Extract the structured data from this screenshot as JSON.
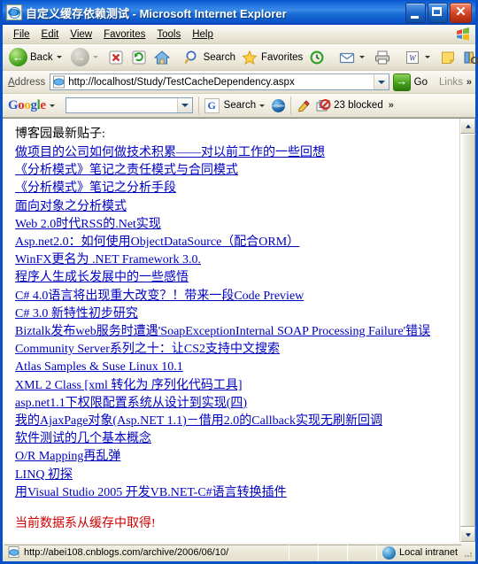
{
  "window": {
    "title_zh": "自定义缓存依赖测试",
    "title_suffix": " - Microsoft Internet Explorer",
    "icon": "ie-page-icon",
    "minimize_label": "_",
    "maximize_label": "□",
    "close_label": "✕"
  },
  "menu": {
    "items": [
      {
        "label": "File",
        "accel": "F"
      },
      {
        "label": "Edit",
        "accel": "E"
      },
      {
        "label": "View",
        "accel": "V"
      },
      {
        "label": "Favorites",
        "accel": "a"
      },
      {
        "label": "Tools",
        "accel": "T"
      },
      {
        "label": "Help",
        "accel": "H"
      }
    ],
    "brand_icon": "windows-flag-icon"
  },
  "toolbar": {
    "back_label": "Back",
    "back_icon": "back-arrow-icon",
    "forward_icon": "forward-arrow-icon",
    "stop_icon": "stop-icon",
    "refresh_icon": "refresh-icon",
    "home_icon": "home-icon",
    "search_label": "Search",
    "search_icon": "magnifier-icon",
    "favorites_label": "Favorites",
    "favorites_icon": "star-icon",
    "history_icon": "history-clock-icon",
    "mail_icon": "mail-icon",
    "print_icon": "printer-icon",
    "word_icon": "word-edit-icon",
    "notes_icon": "notes-icon",
    "research_icon": "research-icon",
    "overflow_label": "»"
  },
  "address": {
    "label": "Address",
    "icon": "ie-page-icon",
    "value": "http://localhost/Study/TestCacheDependency.aspx",
    "placeholder": "",
    "dropdown_icon": "chevron-down-icon",
    "go_label": "Go",
    "go_icon": "go-arrow-icon",
    "links_label": "Links",
    "overflow_label": "»"
  },
  "google_toolbar": {
    "logo_letters": [
      "G",
      "o",
      "o",
      "g",
      "l",
      "e"
    ],
    "dropdown_icon": "chevron-down-icon",
    "search_value": "",
    "search_placeholder": "",
    "g_icon": "google-g-icon",
    "search_label": "Search",
    "globe_icon": "globe-icon",
    "highlight_icon": "highlighter-icon",
    "popup_blocker_icon": "popup-blocked-icon",
    "blocked_label": "23 blocked",
    "overflow_label": "»"
  },
  "page": {
    "heading": "博客园最新贴子:",
    "links": [
      "做项目的公司如何做技术积累——对以前工作的一些回想",
      "《分析模式》笔记之责任模式与合同模式",
      "《分析模式》笔记之分析手段",
      "面向对象之分析模式",
      "Web 2.0时代RSS的.Net实现",
      "Asp.net2.0：如何使用ObjectDataSource（配合ORM）",
      "WinFX更名为 .NET Framework 3.0.",
      "程序人生成长发展中的一些感悟",
      "C# 4.0语言将出现重大改变？！带来一段Code Preview",
      "C# 3.0 新特性初步研究",
      "Biztalk发布web服务时遭遇'SoapExceptionInternal SOAP Processing Failure'错误",
      "Community Server系列之十：让CS2支持中文搜索",
      "Atlas Samples & Suse Linux 10.1",
      "XML 2 Class [xml 转化为 序列化代码工具]",
      "asp.net1.1下权限配置系统从设计到实现(四)",
      "我的AjaxPage对象(Asp.NET 1.1)－借用2.0的Callback实现无刷新回调",
      "软件测试的几个基本概念",
      "O/R Mapping再乱弹",
      "LINQ 初探",
      "用Visual Studio 2005 开发VB.NET-C#语言转换插件"
    ],
    "cache_message": "当前数据系从缓存中取得!",
    "link_color": "#0000c0",
    "message_color": "#cc0000"
  },
  "scrollbar": {
    "up_icon": "scroll-up-arrow-icon",
    "down_icon": "scroll-down-arrow-icon",
    "thumb": "scroll-thumb"
  },
  "status": {
    "icon": "ie-page-icon",
    "url": "http://abei108.cnblogs.com/archive/2006/06/10/",
    "zone_icon": "local-intranet-icon",
    "zone_label": "Local intranet"
  }
}
